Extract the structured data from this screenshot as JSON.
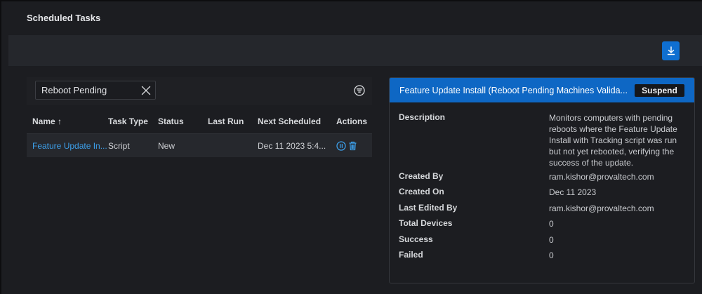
{
  "page": {
    "title": "Scheduled Tasks"
  },
  "toolbar": {
    "download_icon": "download-icon",
    "accent": "#0f6fd1"
  },
  "filter": {
    "search_value": "Reboot Pending",
    "search_placeholder": "Search"
  },
  "table": {
    "columns": [
      "Name",
      "Task Type",
      "Status",
      "Last Run",
      "Next Scheduled",
      "Actions"
    ],
    "sort_indicator": "↑",
    "rows": [
      {
        "name": "Feature Update In...",
        "task_type": "Script",
        "status": "New",
        "last_run": "",
        "next_scheduled": "Dec 11 2023 5:4..."
      }
    ]
  },
  "detail": {
    "title": "Feature Update Install (Reboot Pending Machines Valida...",
    "suspend_label": "Suspend",
    "fields": [
      {
        "label": "Description",
        "value": "Monitors computers with pending reboots where the Feature Update Install with Tracking script was run but not yet rebooted, verifying the success of the update."
      },
      {
        "label": "Created By",
        "value": "ram.kishor@provaltech.com"
      },
      {
        "label": "Created On",
        "value": "Dec 11 2023"
      },
      {
        "label": "Last Edited By",
        "value": "ram.kishor@provaltech.com"
      },
      {
        "label": "Total Devices",
        "value": "0"
      },
      {
        "label": "Success",
        "value": "0"
      },
      {
        "label": "Failed",
        "value": "0"
      }
    ]
  }
}
